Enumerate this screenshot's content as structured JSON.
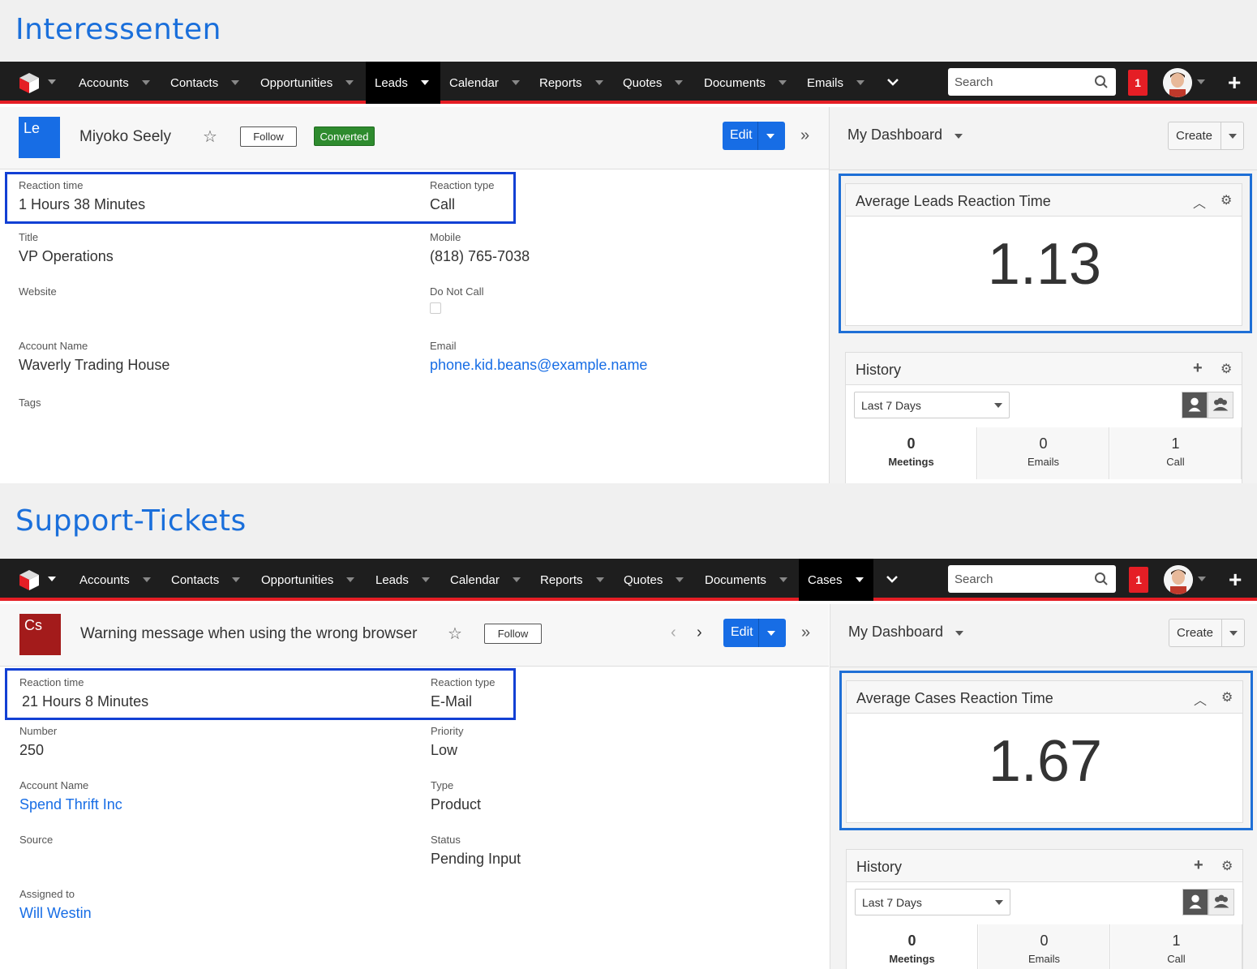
{
  "leads": {
    "section_title": "Interessenten",
    "nav": [
      "Accounts",
      "Contacts",
      "Opportunities",
      "Leads",
      "Calendar",
      "Reports",
      "Quotes",
      "Documents",
      "Emails"
    ],
    "active_nav": "Leads",
    "search_placeholder": "Search",
    "notification_count": "1",
    "record": {
      "icon_text": "Le",
      "icon_color": "#176de5",
      "name": "Miyoko Seely",
      "follow_label": "Follow",
      "status_badge": "Converted",
      "edit_label": "Edit"
    },
    "fields": {
      "reaction_time_label": "Reaction time",
      "reaction_time": "1 Hours 38 Minutes",
      "reaction_type_label": "Reaction type",
      "reaction_type": "Call",
      "title_label": "Title",
      "title": "VP Operations",
      "mobile_label": "Mobile",
      "mobile": "(818) 765-7038",
      "website_label": "Website",
      "do_not_call_label": "Do Not Call",
      "account_name_label": "Account Name",
      "account_name": "Waverly Trading House",
      "email_label": "Email",
      "email": "phone.kid.beans@example.name",
      "tags_label": "Tags"
    },
    "dashboard": {
      "title": "My Dashboard",
      "create_label": "Create",
      "metric_title": "Average Leads Reaction Time",
      "metric_value": "1.13",
      "history_title": "History",
      "history_filter": "Last 7 Days",
      "stats": [
        {
          "count": "0",
          "label": "Meetings"
        },
        {
          "count": "0",
          "label": "Emails"
        },
        {
          "count": "1",
          "label": "Call"
        }
      ]
    }
  },
  "cases": {
    "section_title": "Support-Tickets",
    "nav": [
      "Accounts",
      "Contacts",
      "Opportunities",
      "Leads",
      "Calendar",
      "Reports",
      "Quotes",
      "Documents",
      "Cases"
    ],
    "active_nav": "Cases",
    "search_placeholder": "Search",
    "notification_count": "1",
    "record": {
      "icon_text": "Cs",
      "icon_color": "#a31b1b",
      "name": "Warning message when using the wrong browser",
      "follow_label": "Follow",
      "edit_label": "Edit"
    },
    "fields": {
      "reaction_time_label": "Reaction time",
      "reaction_time": "21 Hours 8 Minutes",
      "reaction_type_label": "Reaction type",
      "reaction_type": "E-Mail",
      "number_label": "Number",
      "number": "250",
      "priority_label": "Priority",
      "priority": "Low",
      "account_name_label": "Account Name",
      "account_name": "Spend Thrift Inc",
      "type_label": "Type",
      "type": "Product",
      "source_label": "Source",
      "status_label": "Status",
      "status": "Pending Input",
      "assigned_to_label": "Assigned to",
      "assigned_to": "Will Westin"
    },
    "dashboard": {
      "title": "My Dashboard",
      "create_label": "Create",
      "metric_title": "Average Cases Reaction Time",
      "metric_value": "1.67",
      "history_title": "History",
      "history_filter": "Last 7 Days",
      "stats": [
        {
          "count": "0",
          "label": "Meetings"
        },
        {
          "count": "0",
          "label": "Emails"
        },
        {
          "count": "1",
          "label": "Call"
        }
      ]
    }
  },
  "colors": {
    "accent": "#176de5",
    "nav_bg": "#1e1e1e",
    "nav_border": "#e51e25",
    "highlight": "#1240d4"
  },
  "icons": [
    "logo-cube-icon",
    "search-icon",
    "star-icon",
    "chevron-double-right-icon",
    "chevron-down-icon",
    "plus-icon",
    "gear-icon",
    "chevron-up-icon",
    "user-icon",
    "group-icon",
    "chevron-left-icon",
    "chevron-right-icon"
  ]
}
